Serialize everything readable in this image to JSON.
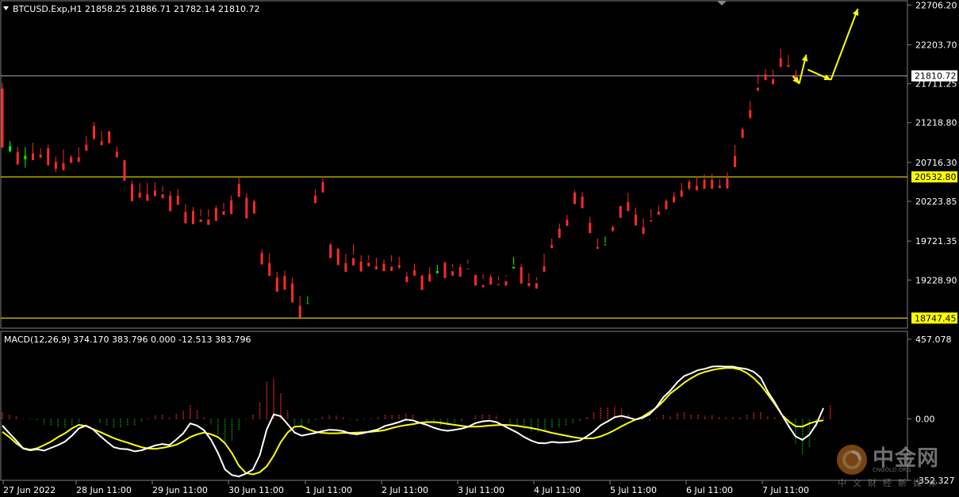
{
  "colors": {
    "background": "#000000",
    "bull": "#00ff00",
    "bear": "#ff2a2a",
    "level_line": "#ffff00",
    "price_line": "#a0a8b8",
    "macd_line": "#ffffff",
    "signal_line": "#ffff00",
    "hist_pos": "#cc2020",
    "hist_neg": "#0a7a0a",
    "arrow": "#ffff00"
  },
  "header": {
    "symbol_info": "BTCUSD.Exp,H1  21858.25 21886.71 21782.14 21810.72"
  },
  "macd_panel": {
    "title": "MACD(12,26,9) 374.170 383.796 0.000 -12.513 383.796"
  },
  "price_axis": {
    "ticks": [
      "22706.20",
      "22203.70",
      "21711.25",
      "21218.80",
      "20716.30",
      "20223.85",
      "19721.35",
      "19228.90"
    ]
  },
  "macd_axis": {
    "ticks": [
      "457.078",
      "0.00",
      "-352.327"
    ]
  },
  "time_axis": {
    "labels": [
      "27 Jun 2022",
      "28 Jun 11:00",
      "29 Jun 11:00",
      "30 Jun 11:00",
      "1 Jul 11:00",
      "2 Jul 11:00",
      "3 Jul 11:00",
      "4 Jul 11:00",
      "5 Jul 11:00",
      "6 Jul 11:00",
      "7 Jul 11:00"
    ]
  },
  "markers": {
    "current_price": "21810.72",
    "level_upper": "20532.80",
    "level_lower": "18747.45"
  },
  "watermark": {
    "name": "中金网",
    "domain": "CNGOLD.ORG",
    "tagline": "中文财经新媒体"
  },
  "chart_data": [
    {
      "type": "candlestick",
      "title": "BTCUSD.Exp,H1",
      "ylim": [
        18640,
        22740
      ],
      "horizontal_lines": [
        21810.72,
        20532.8,
        18747.45
      ],
      "x": [
        "27 Jun 2022",
        "28 Jun 11:00",
        "29 Jun 11:00",
        "30 Jun 11:00",
        "1 Jul 11:00",
        "2 Jul 11:00",
        "3 Jul 11:00",
        "4 Jul 11:00",
        "5 Jul 11:00",
        "6 Jul 11:00",
        "7 Jul 11:00"
      ],
      "ohlc": [
        [
          21650,
          21723,
          20974,
          20903
        ],
        [
          20859,
          20987,
          20842,
          20919
        ],
        [
          20847,
          20918,
          20709,
          20689
        ],
        [
          20757,
          20910,
          20649,
          20800
        ],
        [
          20829,
          20966,
          20749,
          20745
        ],
        [
          20814,
          20896,
          20783,
          20776
        ],
        [
          20895,
          20938,
          20669,
          20684
        ],
        [
          20721,
          20789,
          20591,
          20635
        ],
        [
          20706,
          20877,
          20625,
          20618
        ],
        [
          20781,
          20810,
          20707,
          20714
        ],
        [
          20780,
          20906,
          20725,
          20722
        ],
        [
          20940,
          21048,
          20885,
          20864
        ],
        [
          21175,
          21226,
          21056,
          21011
        ],
        [
          20983,
          21113,
          20972,
          20934
        ],
        [
          21112,
          21110,
          20990,
          20959
        ],
        [
          20851,
          20917,
          20839,
          20779
        ],
        [
          20743,
          20751,
          20513,
          20486
        ],
        [
          20441,
          20483,
          20256,
          20226
        ],
        [
          20332,
          20456,
          20297,
          20270
        ],
        [
          20312,
          20456,
          20287,
          20231
        ],
        [
          20359,
          20465,
          20328,
          20289
        ],
        [
          20315,
          20417,
          20346,
          20262
        ],
        [
          20296,
          20353,
          20157,
          20099
        ],
        [
          20294,
          20379,
          20251,
          20180
        ],
        [
          20088,
          20189,
          20002,
          19945
        ],
        [
          20102,
          20152,
          19953,
          19935
        ],
        [
          19995,
          20121,
          20037,
          19963
        ],
        [
          19997,
          20125,
          20027,
          19926
        ],
        [
          20138,
          20167,
          20014,
          19976
        ],
        [
          20102,
          20206,
          20124,
          20054
        ],
        [
          20235,
          20296,
          20110,
          20063
        ],
        [
          20442,
          20544,
          20338,
          20279
        ],
        [
          20269,
          20323,
          20094,
          20008
        ],
        [
          20221,
          20248,
          20103,
          20068
        ],
        [
          19569,
          19615,
          19473,
          19425
        ],
        [
          19442,
          19570,
          19372,
          19282
        ],
        [
          19259,
          19331,
          19129,
          19081
        ],
        [
          19281,
          19349,
          19156,
          19105
        ],
        [
          19185,
          19257,
          19003,
          18946
        ],
        [
          18903,
          19028,
          18825,
          18752
        ],
        [
          18933,
          19024,
          18943,
          18937
        ],
        [
          20297,
          20373,
          20280,
          20201
        ],
        [
          20464,
          20516,
          20360,
          20336
        ],
        [
          19677,
          19696,
          19512,
          19508
        ],
        [
          19623,
          19631,
          19425,
          19418
        ],
        [
          19441,
          19558,
          19369,
          19332
        ],
        [
          19507,
          19684,
          19549,
          19414
        ],
        [
          19462,
          19543,
          19373,
          19336
        ],
        [
          19449,
          19542,
          19479,
          19402
        ],
        [
          19398,
          19509,
          19376,
          19363
        ],
        [
          19435,
          19489,
          19396,
          19341
        ],
        [
          19397,
          19543,
          19460,
          19344
        ],
        [
          19417,
          19525,
          19368,
          19387
        ],
        [
          19275,
          19330,
          19214,
          19202
        ],
        [
          19351,
          19436,
          19311,
          19284
        ],
        [
          19283,
          19295,
          19161,
          19103
        ],
        [
          19303,
          19393,
          19281,
          19210
        ],
        [
          19316,
          19421,
          19338,
          19342
        ],
        [
          19446,
          19465,
          19344,
          19253
        ],
        [
          19340,
          19430,
          19390,
          19283
        ],
        [
          19391,
          19429,
          19313,
          19271
        ],
        [
          19375,
          19485,
          19437,
          19368
        ],
        [
          19294,
          19274,
          19170,
          19158
        ],
        [
          19165,
          19301,
          19238,
          19137
        ],
        [
          19268,
          19300,
          19185,
          19170
        ],
        [
          19179,
          19274,
          19225,
          19166
        ],
        [
          19214,
          19289,
          19272,
          19158
        ],
        [
          19376,
          19520,
          19423,
          19396
        ],
        [
          19394,
          19431,
          19251,
          19183
        ],
        [
          19195,
          19317,
          19211,
          19150
        ],
        [
          19189,
          19264,
          19225,
          19120
        ],
        [
          19402,
          19561,
          19379,
          19333
        ],
        [
          19671,
          19755,
          19639,
          19634
        ],
        [
          19879,
          19944,
          19771,
          19763
        ],
        [
          19991,
          20052,
          19970,
          19914
        ],
        [
          20336,
          20362,
          20217,
          20189
        ],
        [
          20284,
          20343,
          20164,
          20137
        ],
        [
          19952,
          20028,
          19906,
          19822
        ],
        [
          19646,
          19754,
          19623,
          19626
        ],
        [
          19670,
          19779,
          19697,
          19679
        ],
        [
          19897,
          19922,
          19834,
          19852
        ],
        [
          20165,
          20141,
          20035,
          20015
        ],
        [
          20213,
          20333,
          20117,
          20100
        ],
        [
          20055,
          20144,
          19992,
          19917
        ],
        [
          19896,
          20008,
          19880,
          19810
        ],
        [
          19988,
          20124,
          20014,
          19971
        ],
        [
          20094,
          20169,
          20093,
          20054
        ],
        [
          20230,
          20252,
          20126,
          20123
        ],
        [
          20282,
          20342,
          20255,
          20211
        ],
        [
          20362,
          20456,
          20324,
          20281
        ],
        [
          20469,
          20495,
          20363,
          20388
        ],
        [
          20418,
          20540,
          20400,
          20363
        ],
        [
          20495,
          20566,
          20473,
          20382
        ],
        [
          20494,
          20573,
          20400,
          20383
        ],
        [
          20421,
          20503,
          20412,
          20391
        ],
        [
          20517,
          20591,
          20420,
          20385
        ],
        [
          20796,
          20939,
          20729,
          20658
        ],
        [
          21134,
          21161,
          21038,
          21027
        ],
        [
          21376,
          21493,
          21263,
          21282
        ],
        [
          21662,
          21831,
          21708,
          21622
        ],
        [
          21829,
          21901,
          21752,
          21759
        ],
        [
          21771,
          21889,
          21814,
          21705
        ],
        [
          22032,
          22153,
          21925,
          21923
        ],
        [
          21947,
          22076,
          21918,
          21928
        ],
        [
          21822,
          21886,
          21810,
          21773
        ]
      ],
      "projection": [
        [
          21810.72,
          21711.25
        ],
        [
          21890,
          22080
        ],
        [
          21760,
          21760
        ],
        [
          22660,
          22660
        ]
      ]
    },
    {
      "type": "macd",
      "title": "MACD(12,26,9) 374.170 383.796 0.000 -12.513 383.796",
      "ylim": [
        -352.327,
        457.078
      ],
      "macd": [
        -38,
        -82,
        -124,
        -170,
        -180,
        -174,
        -182,
        -166,
        -150,
        -130,
        -96,
        -54,
        -38,
        -58,
        -96,
        -130,
        -162,
        -172,
        -174,
        -186,
        -180,
        -166,
        -152,
        -144,
        -150,
        -118,
        -82,
        -26,
        -38,
        -66,
        -120,
        -196,
        -290,
        -322,
        -330,
        -314,
        -290,
        -208,
        -60,
        26,
        16,
        -30,
        -78,
        -96,
        -88,
        -80,
        -70,
        -62,
        -64,
        -70,
        -84,
        -88,
        -80,
        -70,
        -60,
        -40,
        -30,
        -18,
        -4,
        -8,
        -22,
        -34,
        -50,
        -62,
        -68,
        -62,
        -56,
        -44,
        -24,
        -14,
        -10,
        -18,
        -38,
        -58,
        -78,
        -104,
        -124,
        -138,
        -140,
        -132,
        -136,
        -134,
        -130,
        -124,
        -100,
        -72,
        -36,
        -14,
        10,
        18,
        8,
        -4,
        6,
        26,
        68,
        124,
        162,
        210,
        246,
        262,
        280,
        288,
        300,
        302,
        300,
        300,
        292,
        286,
        270,
        236,
        158,
        96,
        26,
        -40,
        -100,
        -120,
        -90,
        -30,
        62
      ],
      "signal": [
        -74,
        -104,
        -140,
        -168,
        -176,
        -168,
        -150,
        -130,
        -104,
        -82,
        -54,
        -34,
        -40,
        -58,
        -74,
        -92,
        -110,
        -124,
        -136,
        -150,
        -162,
        -170,
        -172,
        -166,
        -158,
        -148,
        -128,
        -104,
        -88,
        -78,
        -88,
        -104,
        -140,
        -196,
        -268,
        -310,
        -318,
        -306,
        -272,
        -210,
        -134,
        -78,
        -44,
        -42,
        -60,
        -74,
        -80,
        -82,
        -82,
        -80,
        -80,
        -78,
        -76,
        -74,
        -70,
        -64,
        -52,
        -42,
        -36,
        -30,
        -22,
        -18,
        -18,
        -22,
        -28,
        -34,
        -40,
        -44,
        -44,
        -42,
        -38,
        -36,
        -34,
        -36,
        -40,
        -46,
        -52,
        -60,
        -70,
        -80,
        -88,
        -96,
        -104,
        -110,
        -112,
        -110,
        -100,
        -84,
        -64,
        -42,
        -22,
        -4,
        12,
        38,
        64,
        102,
        146,
        176,
        208,
        234,
        256,
        270,
        280,
        288,
        292,
        292,
        284,
        264,
        234,
        194,
        142,
        86,
        26,
        -14,
        -42,
        -44,
        -26,
        -14,
        -8
      ],
      "histogram": [
        36,
        22,
        16,
        -2,
        -4,
        -6,
        -32,
        -36,
        -46,
        -48,
        -42,
        -20,
        2,
        0,
        -22,
        -38,
        -52,
        -48,
        -38,
        -36,
        -18,
        4,
        20,
        22,
        8,
        30,
        46,
        78,
        50,
        12,
        -32,
        -92,
        -150,
        -126,
        -62,
        -4,
        28,
        98,
        212,
        236,
        150,
        48,
        -34,
        -54,
        -28,
        -6,
        10,
        20,
        18,
        10,
        -4,
        -10,
        -4,
        4,
        10,
        24,
        22,
        24,
        32,
        22,
        0,
        -16,
        -32,
        -40,
        -40,
        -28,
        -16,
        0,
        20,
        28,
        28,
        18,
        -4,
        -22,
        -38,
        -58,
        -72,
        -78,
        -70,
        -52,
        -48,
        -38,
        -26,
        -14,
        12,
        38,
        64,
        70,
        74,
        60,
        30,
        0,
        -6,
        -12,
        4,
        22,
        16,
        34,
        38,
        28,
        24,
        18,
        20,
        14,
        8,
        8,
        8,
        22,
        36,
        42,
        16,
        10,
        0,
        -54,
        -142,
        -206,
        -160,
        -46,
        16,
        76
      ]
    }
  ]
}
